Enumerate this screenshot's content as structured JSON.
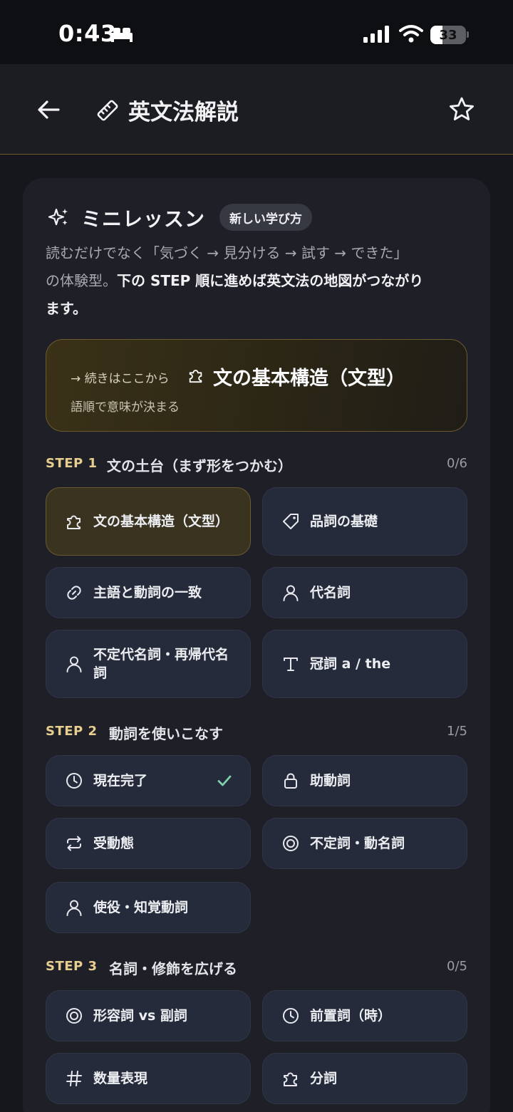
{
  "status_bar": {
    "time": "0:43",
    "battery": "33",
    "battery_level": 0.33
  },
  "header": {
    "title": "英文法解説"
  },
  "card": {
    "title": "ミニレッスン",
    "badge": "新しい学び方",
    "intro_line1": "読むだけでなく「気づく → 見分ける → 試す → できた」",
    "intro_line2_plain": "の体験型。",
    "intro_line2_bold": "下の STEP 順に進めば英文法の地図がつながり",
    "intro_line3_bold": "ます。",
    "continue": {
      "lead": "→ 続きはここから",
      "title": "文の基本構造（文型）",
      "subtitle": "語順で意味が決まる"
    },
    "steps": [
      {
        "label": "STEP 1",
        "title": "文の土台（まず形をつかむ）",
        "progress": "0/6",
        "topics": [
          {
            "label": "文の基本構造（文型）",
            "icon": "puzzle-icon",
            "active": true
          },
          {
            "label": "品詞の基礎",
            "icon": "tag-icon"
          },
          {
            "label": "主語と動詞の一致",
            "icon": "link-icon"
          },
          {
            "label": "代名詞",
            "icon": "person-icon"
          },
          {
            "label": "不定代名詞・再帰代名詞",
            "icon": "person-icon"
          },
          {
            "label": "冠詞 a / the",
            "icon": "type-icon"
          }
        ]
      },
      {
        "label": "STEP 2",
        "title": "動詞を使いこなす",
        "progress": "1/5",
        "topics": [
          {
            "label": "現在完了",
            "icon": "clock-icon",
            "done": true
          },
          {
            "label": "助動詞",
            "icon": "lock-icon"
          },
          {
            "label": "受動態",
            "icon": "repeat-icon"
          },
          {
            "label": "不定詞・動名詞",
            "icon": "target-icon"
          },
          {
            "label": "使役・知覚動詞",
            "icon": "person-icon"
          }
        ]
      },
      {
        "label": "STEP 3",
        "title": "名詞・修飾を広げる",
        "progress": "0/5",
        "topics": [
          {
            "label": "形容詞 vs 副詞",
            "icon": "target-icon"
          },
          {
            "label": "前置詞（時）",
            "icon": "clock-icon"
          },
          {
            "label": "数量表現",
            "icon": "hash-icon"
          },
          {
            "label": "分詞",
            "icon": "puzzle-icon"
          }
        ]
      }
    ]
  },
  "colors": {
    "accent_gold": "#e7cd8e",
    "done_check": "#7fd1ae",
    "tile_bg": "#252b3a"
  }
}
